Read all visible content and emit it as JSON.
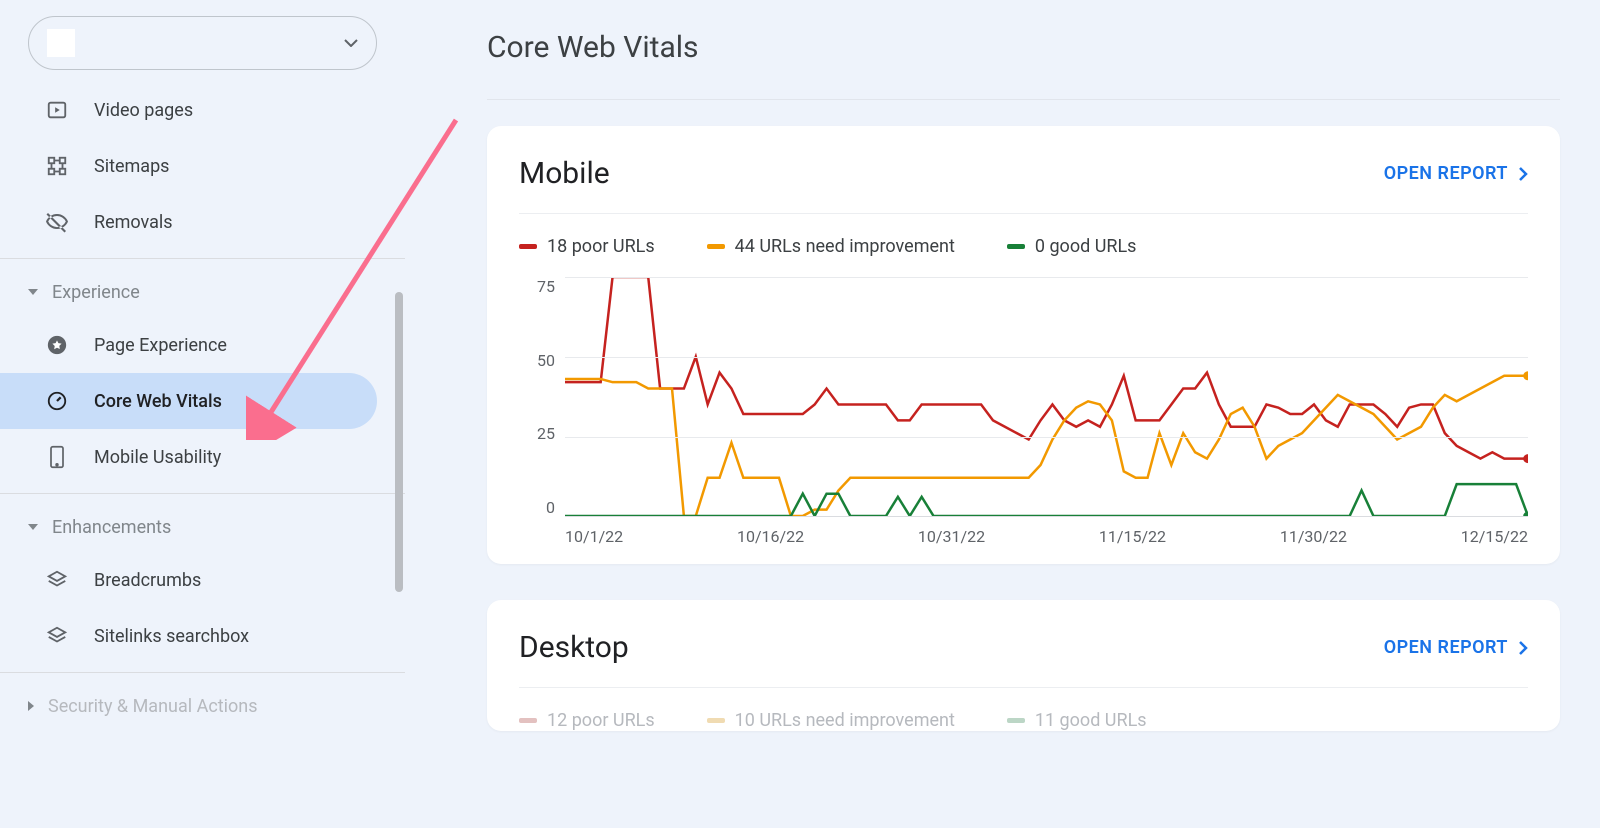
{
  "property_selector": {
    "label": ""
  },
  "sidebar": {
    "items_top": [
      {
        "label": "Video pages",
        "icon": "video-pages-icon"
      },
      {
        "label": "Sitemaps",
        "icon": "sitemaps-icon"
      },
      {
        "label": "Removals",
        "icon": "removals-icon"
      }
    ],
    "section_experience": "Experience",
    "experience_items": [
      {
        "label": "Page Experience",
        "icon": "page-experience-icon"
      },
      {
        "label": "Core Web Vitals",
        "icon": "core-web-vitals-icon",
        "active": true
      },
      {
        "label": "Mobile Usability",
        "icon": "mobile-usability-icon"
      }
    ],
    "section_enhancements": "Enhancements",
    "enhancements_items": [
      {
        "label": "Breadcrumbs",
        "icon": "breadcrumbs-icon"
      },
      {
        "label": "Sitelinks searchbox",
        "icon": "sitelinks-searchbox-icon"
      }
    ],
    "section_security": "Security & Manual Actions"
  },
  "page": {
    "title": "Core Web Vitals",
    "open_report": "OPEN REPORT"
  },
  "mobile_card": {
    "title": "Mobile",
    "legend": {
      "poor": "18 poor URLs",
      "improve": "44 URLs need improvement",
      "good": "0 good URLs"
    }
  },
  "desktop_card": {
    "title": "Desktop",
    "legend": {
      "poor": "12 poor URLs",
      "improve": "10 URLs need improvement",
      "good": "11 good URLs"
    }
  },
  "chart_data": {
    "type": "line",
    "title": "Mobile Core Web Vitals URL counts over time",
    "xlabel": "",
    "ylabel": "",
    "ylim": [
      0,
      75
    ],
    "yticks": [
      0,
      25,
      50,
      75
    ],
    "xticks": [
      "10/1/22",
      "10/16/22",
      "10/31/22",
      "11/15/22",
      "11/30/22",
      "12/15/22"
    ],
    "colors": {
      "poor": "#c5221f",
      "improve": "#f29900",
      "good": "#188038"
    },
    "series": [
      {
        "name": "poor URLs",
        "values": [
          42,
          42,
          42,
          42,
          75,
          75,
          75,
          75,
          40,
          40,
          40,
          50,
          35,
          45,
          40,
          32,
          32,
          32,
          32,
          32,
          32,
          35,
          40,
          35,
          35,
          35,
          35,
          35,
          30,
          30,
          35,
          35,
          35,
          35,
          35,
          35,
          30,
          28,
          26,
          24,
          30,
          35,
          30,
          28,
          30,
          28,
          35,
          44,
          30,
          30,
          30,
          35,
          40,
          40,
          45,
          35,
          28,
          28,
          28,
          35,
          34,
          32,
          32,
          35,
          30,
          28,
          35,
          35,
          35,
          32,
          28,
          34,
          35,
          35,
          26,
          22,
          20,
          18,
          20,
          18,
          18,
          18
        ]
      },
      {
        "name": "URLs need improvement",
        "values": [
          43,
          43,
          43,
          43,
          42,
          42,
          42,
          40,
          40,
          40,
          0,
          0,
          12,
          12,
          23,
          12,
          12,
          12,
          12,
          0,
          0,
          2,
          2,
          8,
          12,
          12,
          12,
          12,
          12,
          12,
          12,
          12,
          12,
          12,
          12,
          12,
          12,
          12,
          12,
          12,
          16,
          24,
          30,
          34,
          36,
          35,
          30,
          14,
          12,
          12,
          26,
          16,
          26,
          20,
          18,
          24,
          32,
          34,
          28,
          18,
          22,
          24,
          26,
          30,
          34,
          38,
          36,
          34,
          32,
          28,
          24,
          26,
          28,
          34,
          38,
          36,
          38,
          40,
          42,
          44,
          44,
          44
        ]
      },
      {
        "name": "good URLs",
        "values": [
          0,
          0,
          0,
          0,
          0,
          0,
          0,
          0,
          0,
          0,
          0,
          0,
          0,
          0,
          0,
          0,
          0,
          0,
          0,
          0,
          7,
          0,
          7,
          7,
          0,
          0,
          0,
          0,
          6,
          0,
          6,
          0,
          0,
          0,
          0,
          0,
          0,
          0,
          0,
          0,
          0,
          0,
          0,
          0,
          0,
          0,
          0,
          0,
          0,
          0,
          0,
          0,
          0,
          0,
          0,
          0,
          0,
          0,
          0,
          0,
          0,
          0,
          0,
          0,
          0,
          0,
          0,
          8,
          0,
          0,
          0,
          0,
          0,
          0,
          0,
          10,
          10,
          10,
          10,
          10,
          10,
          0
        ]
      }
    ]
  }
}
